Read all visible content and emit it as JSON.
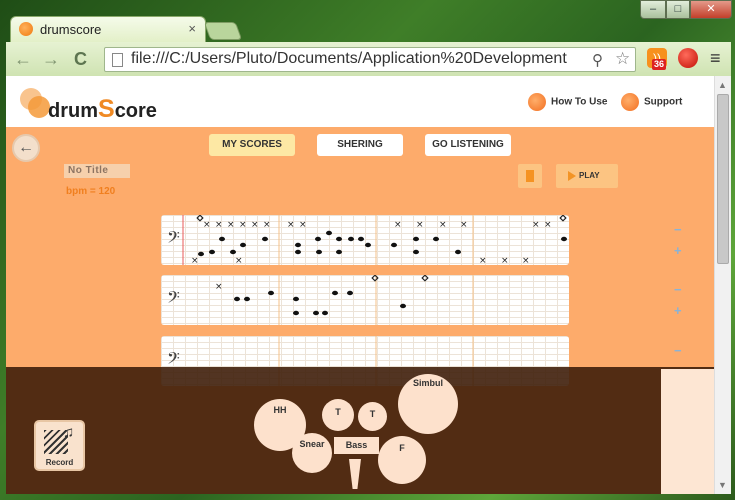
{
  "browser": {
    "tab_title": "drumscore",
    "tab_close": "×",
    "window_min": "–",
    "window_max": "□",
    "window_close": "✕",
    "back": "←",
    "forward": "→",
    "reload": "C",
    "url": "file:///C:/Users/Pluto/Documents/Application%20Development",
    "rss_badge": "36",
    "menu": "≡"
  },
  "app": {
    "logo_prefix": "drum",
    "logo_s": "S",
    "logo_suffix": "core",
    "links": {
      "how_to_use": "How To Use",
      "support": "Support"
    },
    "back_label": "←",
    "tabs": {
      "my_scores": "MY SCORES",
      "shering": "SHERING",
      "go_listening": "GO LISTENING"
    },
    "song_title": "No Title",
    "bpm_label": "bpm = 120",
    "play_label": "PLAY",
    "staff_clef": "𝄢",
    "side_controls": {
      "minus": "−",
      "plus": "+"
    },
    "record_label": "Record",
    "record_note": "♫",
    "drums": {
      "hh": "HH",
      "tom1": "T",
      "tom2": "T",
      "simbul": "Simbul",
      "snear": "Snear",
      "bass": "Bass",
      "floor": "F"
    }
  },
  "colors": {
    "accent": "#f08a24",
    "page_bg": "#fdab6b",
    "active_tab": "#fde8a4",
    "drum_overlay": "#3f1e0a",
    "drum_fill": "#fde1cc"
  },
  "icons": [
    "page-icon",
    "search-icon",
    "star-icon",
    "rss-icon",
    "extension-icon",
    "menu-icon",
    "back-arrow-icon",
    "stop-icon",
    "play-icon",
    "record-icon",
    "bass-clef-icon"
  ]
}
